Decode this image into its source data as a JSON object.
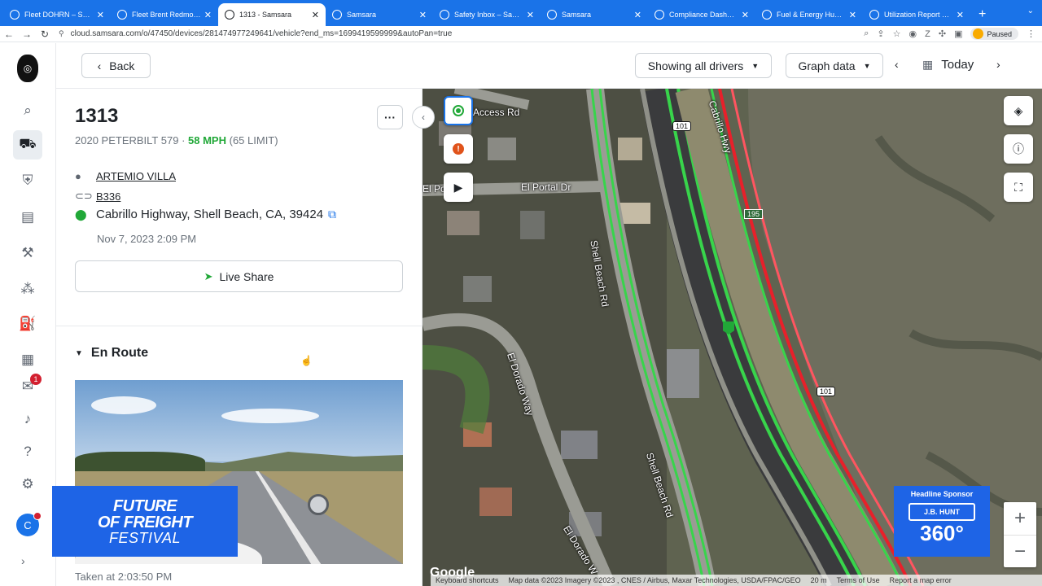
{
  "browser": {
    "tabs": [
      {
        "label": "Fleet DOHRN – Samsara",
        "active": false
      },
      {
        "label": "Fleet Brent Redmond L",
        "active": false
      },
      {
        "label": "1313 - Samsara",
        "active": true
      },
      {
        "label": "Samsara",
        "active": false
      },
      {
        "label": "Safety Inbox – Samsara",
        "active": false
      },
      {
        "label": "Samsara",
        "active": false
      },
      {
        "label": "Compliance Dashboard",
        "active": false
      },
      {
        "label": "Fuel & Energy Hub – Sa",
        "active": false
      },
      {
        "label": "Utilization Report – Sa",
        "active": false
      }
    ],
    "url": "cloud.samsara.com/o/47450/devices/281474977249641/vehicle?end_ms=1699419599999&autoPan=true",
    "profile_status": "Paused"
  },
  "nav": {
    "items": [
      {
        "name": "search",
        "icon": "search-icon",
        "glyph": "⌕"
      },
      {
        "name": "fleet",
        "icon": "fleet-map-icon",
        "glyph": "⛟"
      },
      {
        "name": "safety",
        "icon": "shield-icon",
        "glyph": "⛨"
      },
      {
        "name": "compliance",
        "icon": "clipboard-icon",
        "glyph": "▤"
      },
      {
        "name": "maintenance",
        "icon": "wrench-icon",
        "glyph": "⚒"
      },
      {
        "name": "dispatch",
        "icon": "route-icon",
        "glyph": "⁂"
      },
      {
        "name": "fuel",
        "icon": "fuel-icon",
        "glyph": "⛽"
      },
      {
        "name": "documents",
        "icon": "document-icon",
        "glyph": "▦"
      },
      {
        "name": "messages",
        "icon": "chat-icon",
        "glyph": "✉",
        "badge": "1"
      },
      {
        "name": "alerts",
        "icon": "bell-icon",
        "glyph": "♪"
      },
      {
        "name": "help",
        "icon": "help-icon",
        "glyph": "?"
      },
      {
        "name": "settings",
        "icon": "gear-icon",
        "glyph": "⚙"
      }
    ],
    "user_initial": "C",
    "expand_glyph": "›"
  },
  "topbar": {
    "back_label": "Back",
    "drivers_filter": "Showing all drivers",
    "graph_label": "Graph data",
    "date_label": "Today"
  },
  "vehicle": {
    "name": "1313",
    "model": "2020 PETERBILT 579",
    "separator": "·",
    "speed": "58 MPH",
    "limit": "(65 LIMIT)",
    "driver": "ARTEMIO VILLA",
    "trailer": "B336",
    "address": "Cabrillo Highway, Shell Beach, CA, 39424",
    "timestamp": "Nov 7, 2023 2:09 PM",
    "live_share_label": "Live Share",
    "section_title": "En Route",
    "camera_taken": "Taken at 2:03:50 PM"
  },
  "map": {
    "labels": {
      "access_rd": "Access Rd",
      "el_po": "El Po",
      "el_portal": "El Portal Dr",
      "shell_beach_1": "Shell Beach Rd",
      "shell_beach_2": "Shell Beach Rd",
      "el_dorado_1": "El Dorado Way",
      "el_dorado_2": "El Dorado W",
      "cabrillo": "Cabrillo Hwy"
    },
    "shields": {
      "us101_top": "101",
      "ca195": "195",
      "us101_bottom": "101"
    },
    "google": "Google",
    "attribution": [
      "Keyboard shortcuts",
      "Map data ©2023 Imagery ©2023 , CNES / Airbus, Maxar Technologies, USDA/FPAC/GEO",
      "20 m",
      "Terms of Use",
      "Report a map error"
    ],
    "zoom_in": "+",
    "zoom_out": "−",
    "colors": {
      "route_green": "#38d44b",
      "route_red": "#e8202a",
      "brand_blue": "#1e64e6"
    }
  },
  "overlay": {
    "festival_line1": "FUTURE",
    "festival_line2": "OF FREIGHT",
    "festival_line3": "FESTIVAL",
    "sponsor_title": "Headline Sponsor",
    "sponsor_brand": "J.B. HUNT",
    "sponsor_360": "360°"
  }
}
